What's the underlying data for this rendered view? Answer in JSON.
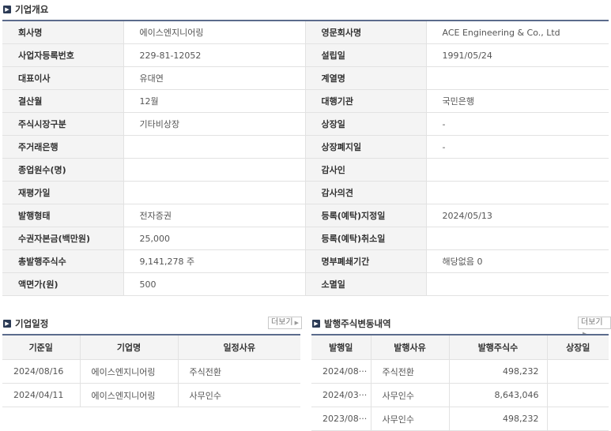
{
  "overview": {
    "title": "기업개요",
    "rows": [
      [
        "회사명",
        "에이스엔지니어링",
        "영문회사명",
        "ACE Engineering & Co., Ltd"
      ],
      [
        "사업자등록번호",
        "229-81-12052",
        "설립일",
        "1991/05/24"
      ],
      [
        "대표이사",
        "유대연",
        "계열명",
        ""
      ],
      [
        "결산월",
        "12월",
        "대행기관",
        "국민은행"
      ],
      [
        "주식시장구분",
        "기타비상장",
        "상장일",
        "-"
      ],
      [
        "주거래은행",
        "",
        "상장폐지일",
        "-"
      ],
      [
        "종업원수(명)",
        "",
        "감사인",
        ""
      ],
      [
        "재평가일",
        "",
        "감사의견",
        ""
      ],
      [
        "발행형태",
        "전자증권",
        "등록(예탁)지정일",
        "2024/05/13"
      ],
      [
        "수권자본금(백만원)",
        "25,000",
        "등록(예탁)취소일",
        ""
      ],
      [
        "총발행주식수",
        "9,141,278 주",
        "명부폐쇄기간",
        "해당없음 0"
      ],
      [
        "액면가(원)",
        "500",
        "소멸일",
        ""
      ]
    ]
  },
  "schedule": {
    "title": "기업일정",
    "more_label": "더보기",
    "headers": [
      "기준일",
      "기업명",
      "일정사유"
    ],
    "rows": [
      [
        "2024/08/16",
        "에이스엔지니어링",
        "주식전환"
      ],
      [
        "2024/04/11",
        "에이스엔지니어링",
        "사무인수"
      ]
    ]
  },
  "stock_changes": {
    "title": "발행주식변동내역",
    "more_label": "더보기",
    "headers": [
      "발행일",
      "발행사유",
      "발행주식수",
      "상장일"
    ],
    "rows": [
      [
        "2024/08···",
        "주식전환",
        "498,232",
        ""
      ],
      [
        "2024/03···",
        "사무인수",
        "8,643,046",
        ""
      ],
      [
        "2023/08···",
        "사무인수",
        "498,232",
        ""
      ]
    ]
  }
}
